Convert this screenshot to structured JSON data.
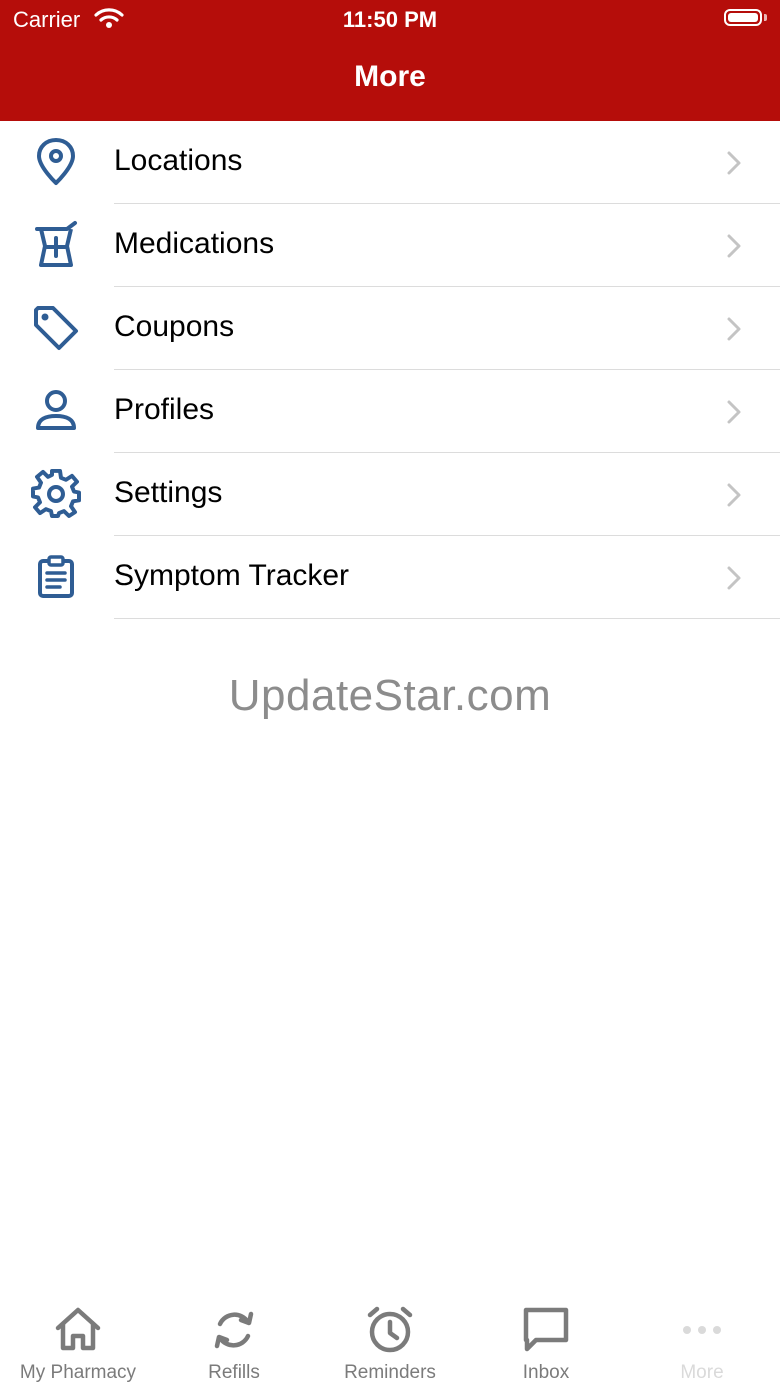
{
  "status_bar": {
    "carrier": "Carrier",
    "time": "11:50 PM"
  },
  "nav": {
    "title": "More"
  },
  "menu": [
    {
      "label": "Locations",
      "icon": "location-pin-icon"
    },
    {
      "label": "Medications",
      "icon": "medication-icon"
    },
    {
      "label": "Coupons",
      "icon": "tag-icon"
    },
    {
      "label": "Profiles",
      "icon": "person-icon"
    },
    {
      "label": "Settings",
      "icon": "gear-icon"
    },
    {
      "label": "Symptom Tracker",
      "icon": "clipboard-icon"
    }
  ],
  "watermark": "UpdateStar.com",
  "tabs": [
    {
      "label": "My Pharmacy",
      "icon": "home-icon"
    },
    {
      "label": "Refills",
      "icon": "refresh-icon"
    },
    {
      "label": "Reminders",
      "icon": "alarm-clock-icon"
    },
    {
      "label": "Inbox",
      "icon": "chat-bubble-icon"
    },
    {
      "label": "More",
      "icon": "more-dots-icon"
    }
  ],
  "colors": {
    "header": "#b50d0a",
    "icon": "#2f5d94",
    "tab_icon": "#7b7b7b",
    "tab_active": "#dadada"
  }
}
